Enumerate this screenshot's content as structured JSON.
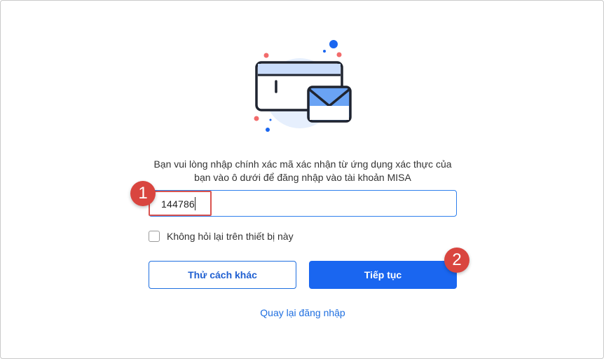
{
  "illustration": {
    "icon": "card-and-envelope-illustration"
  },
  "instruction": {
    "line1": "Bạn vui lòng nhập chính xác mã xác nhận từ ứng dụng xác thực của",
    "line2": "bạn vào ô dưới để đăng nhập vào tài khoản MISA"
  },
  "code_input": {
    "value": "144786"
  },
  "annotations": {
    "step1": "1",
    "step2": "2",
    "highlight_color": "#d9534f"
  },
  "remember": {
    "label": "Không hỏi lại trên thiết bị này",
    "checked": false
  },
  "buttons": {
    "other_method": "Thử cách khác",
    "continue": "Tiếp tục"
  },
  "back_link": "Quay lại đăng nhập",
  "colors": {
    "primary": "#1a66f0",
    "badge": "#d9453f"
  }
}
